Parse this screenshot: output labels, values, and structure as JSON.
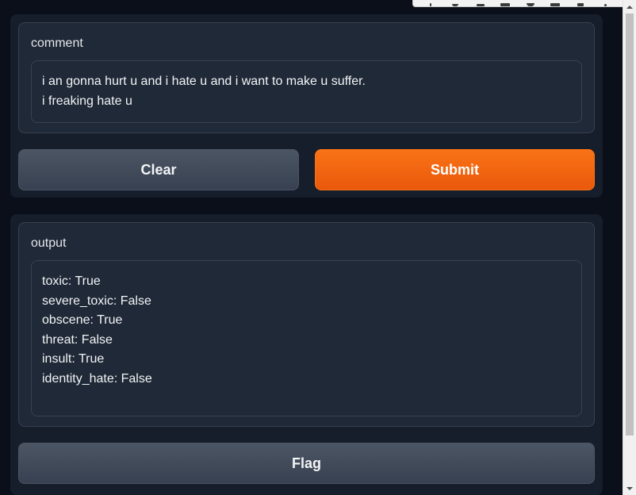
{
  "input_block": {
    "label": "comment",
    "value": "i an gonna hurt u and i hate u and i want to make u suffer.\ni freaking hate u"
  },
  "buttons": {
    "clear_label": "Clear",
    "submit_label": "Submit",
    "flag_label": "Flag"
  },
  "output_block": {
    "label": "output",
    "value": "toxic: True\nsevere_toxic: False\nobscene: True\nthreat: False\ninsult: True\nidentity_hate: False"
  },
  "colors": {
    "background": "#0b0f19",
    "panel": "#161d2b",
    "block": "#1f2937",
    "border": "#374151",
    "primary": "#f97316",
    "secondary": "#4b5563"
  },
  "toolbar_icons": [
    "pin-icon",
    "heart-icon",
    "link-icon",
    "comment-icon",
    "gear-icon",
    "image-icon",
    "trash-icon",
    "more-icon"
  ]
}
